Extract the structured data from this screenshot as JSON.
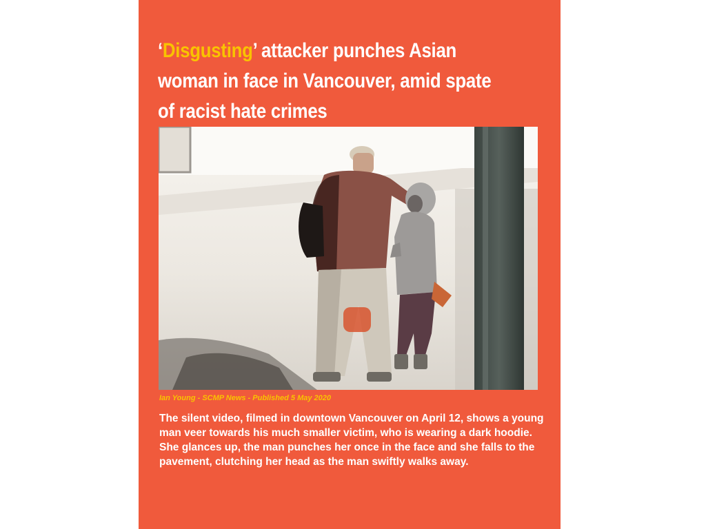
{
  "article": {
    "headline_quote_open": "‘",
    "headline_accent": "Disgusting",
    "headline_quote_close": "’",
    "headline_rest": " attacker punches Asian woman in face in Vancouver, amid spate of racist hate crimes",
    "caption": "Ian Young - SCMP News - Published 5 May 2020",
    "body": "The silent video, filmed in downtown Vancouver on April 12, shows a young man veer towards his much smaller victim, who is wearing a dark hoodie. She glances up, the man punches her once in the face and she falls to the pavement, clutching her head as the man swiftly walks away."
  },
  "colors": {
    "background": "#f05a3c",
    "accent": "#f9c300",
    "text": "#ffffff"
  }
}
